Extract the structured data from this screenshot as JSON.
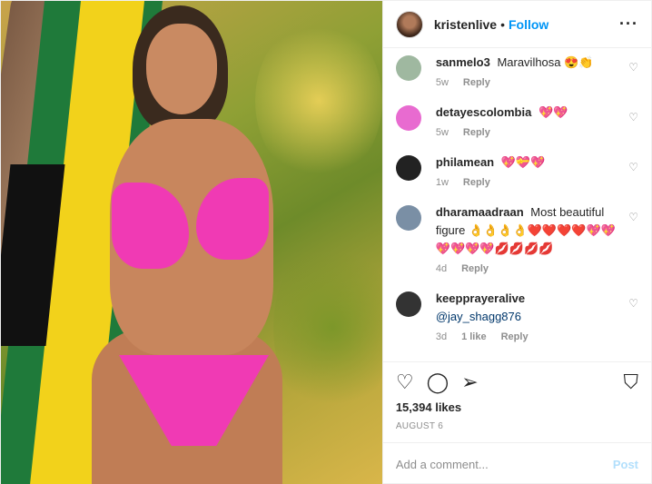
{
  "header": {
    "username": "kristenlive",
    "separator": "•",
    "follow_label": "Follow",
    "more_label": "···"
  },
  "comments": [
    {
      "user": "sanmelo3",
      "text": "Maravilhosa",
      "emoji": "😍👏",
      "age": "5w",
      "likes": "",
      "reply_label": "Reply",
      "avatar_color": "#9fb8a0"
    },
    {
      "user": "detayescolombia",
      "text": "",
      "emoji": "💖💖",
      "age": "5w",
      "likes": "",
      "reply_label": "Reply",
      "avatar_color": "#e86bd0"
    },
    {
      "user": "philamean",
      "text": "",
      "emoji": "💖💝💖",
      "age": "1w",
      "likes": "",
      "reply_label": "Reply",
      "avatar_color": "#222222"
    },
    {
      "user": "dharamaadraan",
      "text": "Most beautiful figure",
      "emoji": "👌👌👌👌❤️❤️❤️❤️💖💖💖💖💖💖💋💋💋💋",
      "age": "4d",
      "likes": "",
      "reply_label": "Reply",
      "avatar_color": "#7a8fa5"
    },
    {
      "user": "keepprayeralive",
      "text": "",
      "mention": "@jay_shagg876",
      "emoji": "",
      "age": "3d",
      "likes": "1 like",
      "reply_label": "Reply",
      "avatar_color": "#333333"
    }
  ],
  "actions": {
    "like_icon": "heart-outline",
    "comment_icon": "speech-bubble",
    "share_icon": "paper-plane",
    "save_icon": "bookmark",
    "likes_text": "15,394 likes"
  },
  "date": "AUGUST 6",
  "add_comment": {
    "placeholder": "Add a comment...",
    "post_label": "Post"
  },
  "colors": {
    "accent": "#0095f6",
    "post_disabled": "#b2dffc",
    "muted": "#8e8e8e"
  }
}
